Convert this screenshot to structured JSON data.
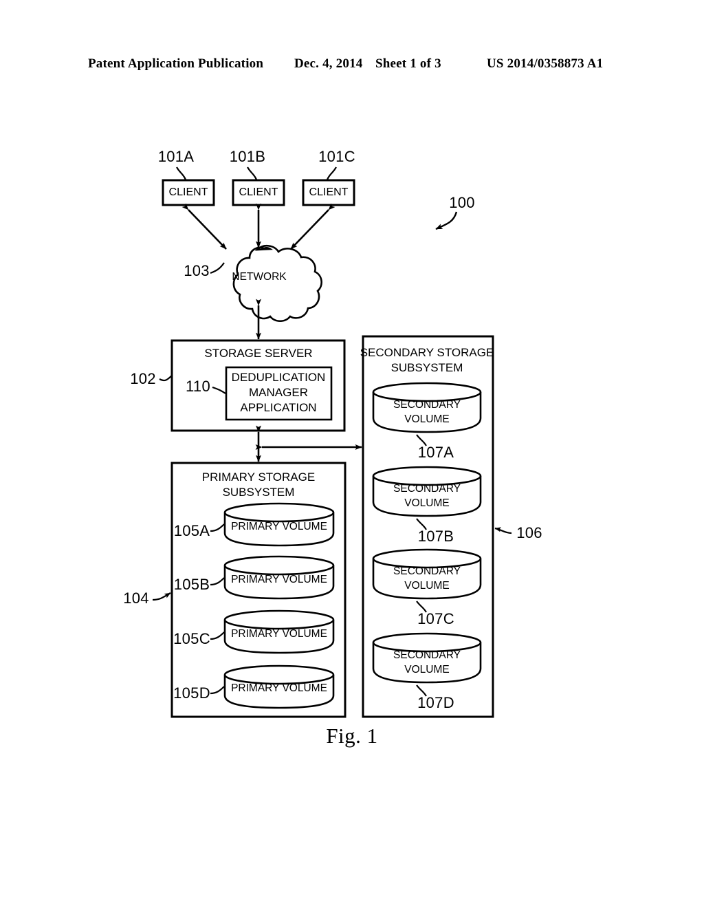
{
  "header": {
    "publication": "Patent Application Publication",
    "date": "Dec. 4, 2014",
    "sheet": "Sheet 1 of 3",
    "patent_number": "US 2014/0358873 A1"
  },
  "figure": {
    "caption": "Fig. 1",
    "system_ref": "100",
    "clients": [
      {
        "ref": "101A",
        "label": "CLIENT"
      },
      {
        "ref": "101B",
        "label": "CLIENT"
      },
      {
        "ref": "101C",
        "label": "CLIENT"
      }
    ],
    "network": {
      "ref": "103",
      "label": "NETWORK"
    },
    "storage_server": {
      "ref": "102",
      "label": "STORAGE SERVER",
      "inner": {
        "ref": "110",
        "line1": "DEDUPLICATION",
        "line2": "MANAGER",
        "line3": "APPLICATION"
      }
    },
    "primary_subsystem": {
      "ref": "104",
      "title_line1": "PRIMARY STORAGE",
      "title_line2": "SUBSYSTEM",
      "volumes": [
        {
          "ref": "105A",
          "label": "PRIMARY VOLUME"
        },
        {
          "ref": "105B",
          "label": "PRIMARY VOLUME"
        },
        {
          "ref": "105C",
          "label": "PRIMARY VOLUME"
        },
        {
          "ref": "105D",
          "label": "PRIMARY VOLUME"
        }
      ]
    },
    "secondary_subsystem": {
      "ref": "106",
      "title_line1": "SECONDARY STORAGE",
      "title_line2": "SUBSYSTEM",
      "volumes": [
        {
          "ref": "107A",
          "line1": "SECONDARY",
          "line2": "VOLUME"
        },
        {
          "ref": "107B",
          "line1": "SECONDARY",
          "line2": "VOLUME"
        },
        {
          "ref": "107C",
          "line1": "SECONDARY",
          "line2": "VOLUME"
        },
        {
          "ref": "107D",
          "line1": "SECONDARY",
          "line2": "VOLUME"
        }
      ]
    }
  },
  "colors": {
    "ink": "#000000",
    "paper": "#ffffff"
  }
}
